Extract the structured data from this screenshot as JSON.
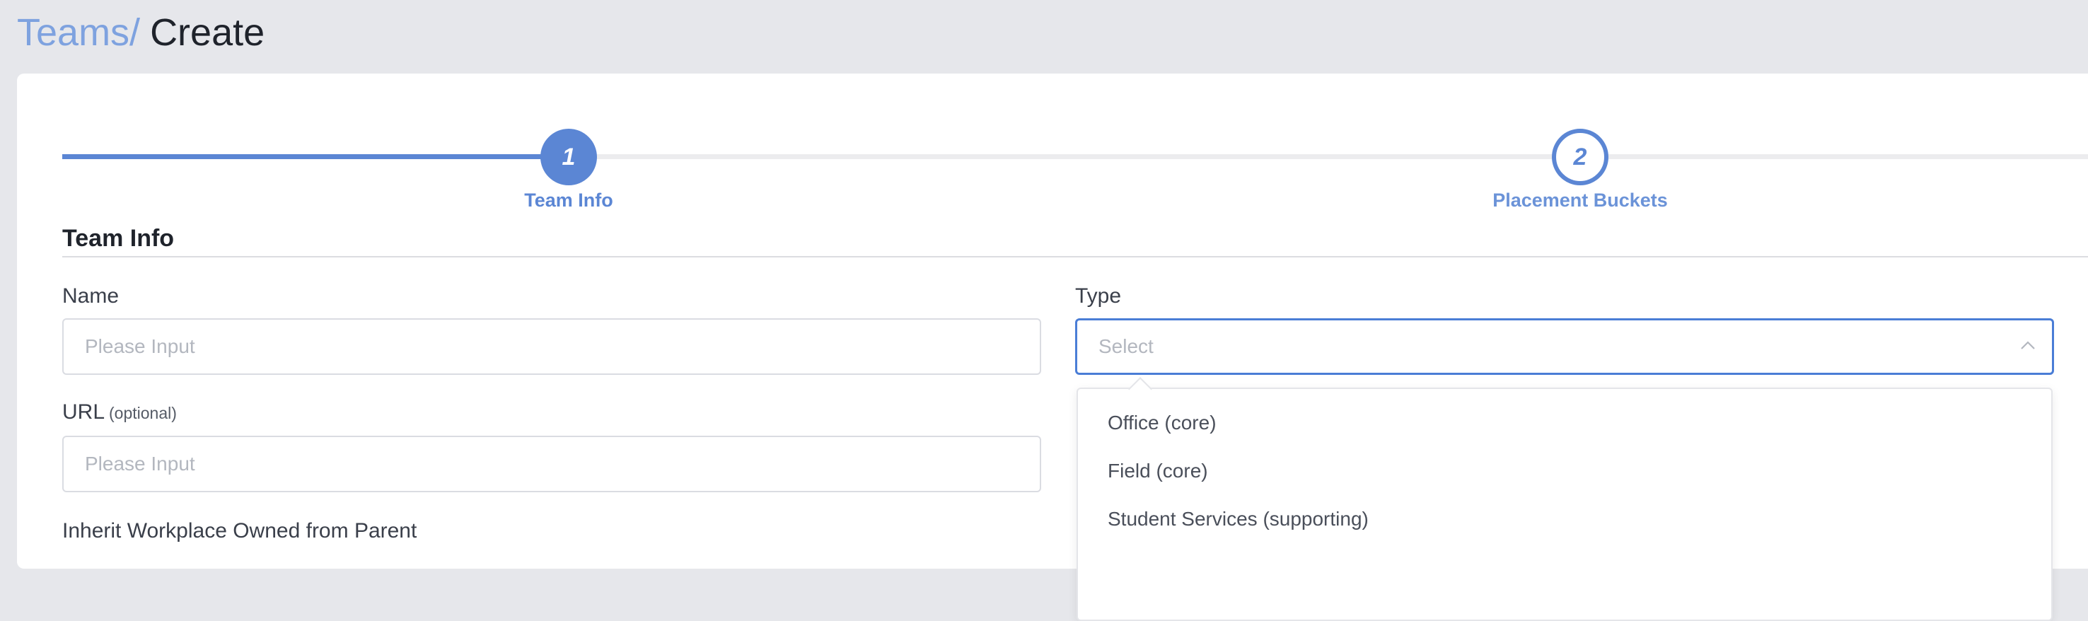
{
  "breadcrumb": {
    "parent": "Teams",
    "separator": "/",
    "current": "Create"
  },
  "stepper": {
    "active_step": 1,
    "steps": [
      {
        "number": "1",
        "label": "Team Info"
      },
      {
        "number": "2",
        "label": "Placement Buckets"
      }
    ]
  },
  "section": {
    "title": "Team Info"
  },
  "form": {
    "name": {
      "label": "Name",
      "value": "",
      "placeholder": "Please Input"
    },
    "url": {
      "label": "URL",
      "optional": "(optional)",
      "value": "",
      "placeholder": "Please Input"
    },
    "type": {
      "label": "Type",
      "placeholder": "Select",
      "selected": "",
      "expanded": true,
      "options": [
        "Office (core)",
        "Field (core)",
        "Student Services (supporting)"
      ]
    },
    "inherit": {
      "label": "Inherit Workplace Owned from Parent"
    }
  },
  "colors": {
    "accent": "#5b86d4",
    "focus_border": "#4a7dd6",
    "background": "#e6e7eb",
    "breadcrumb_link": "#7ea2df"
  }
}
